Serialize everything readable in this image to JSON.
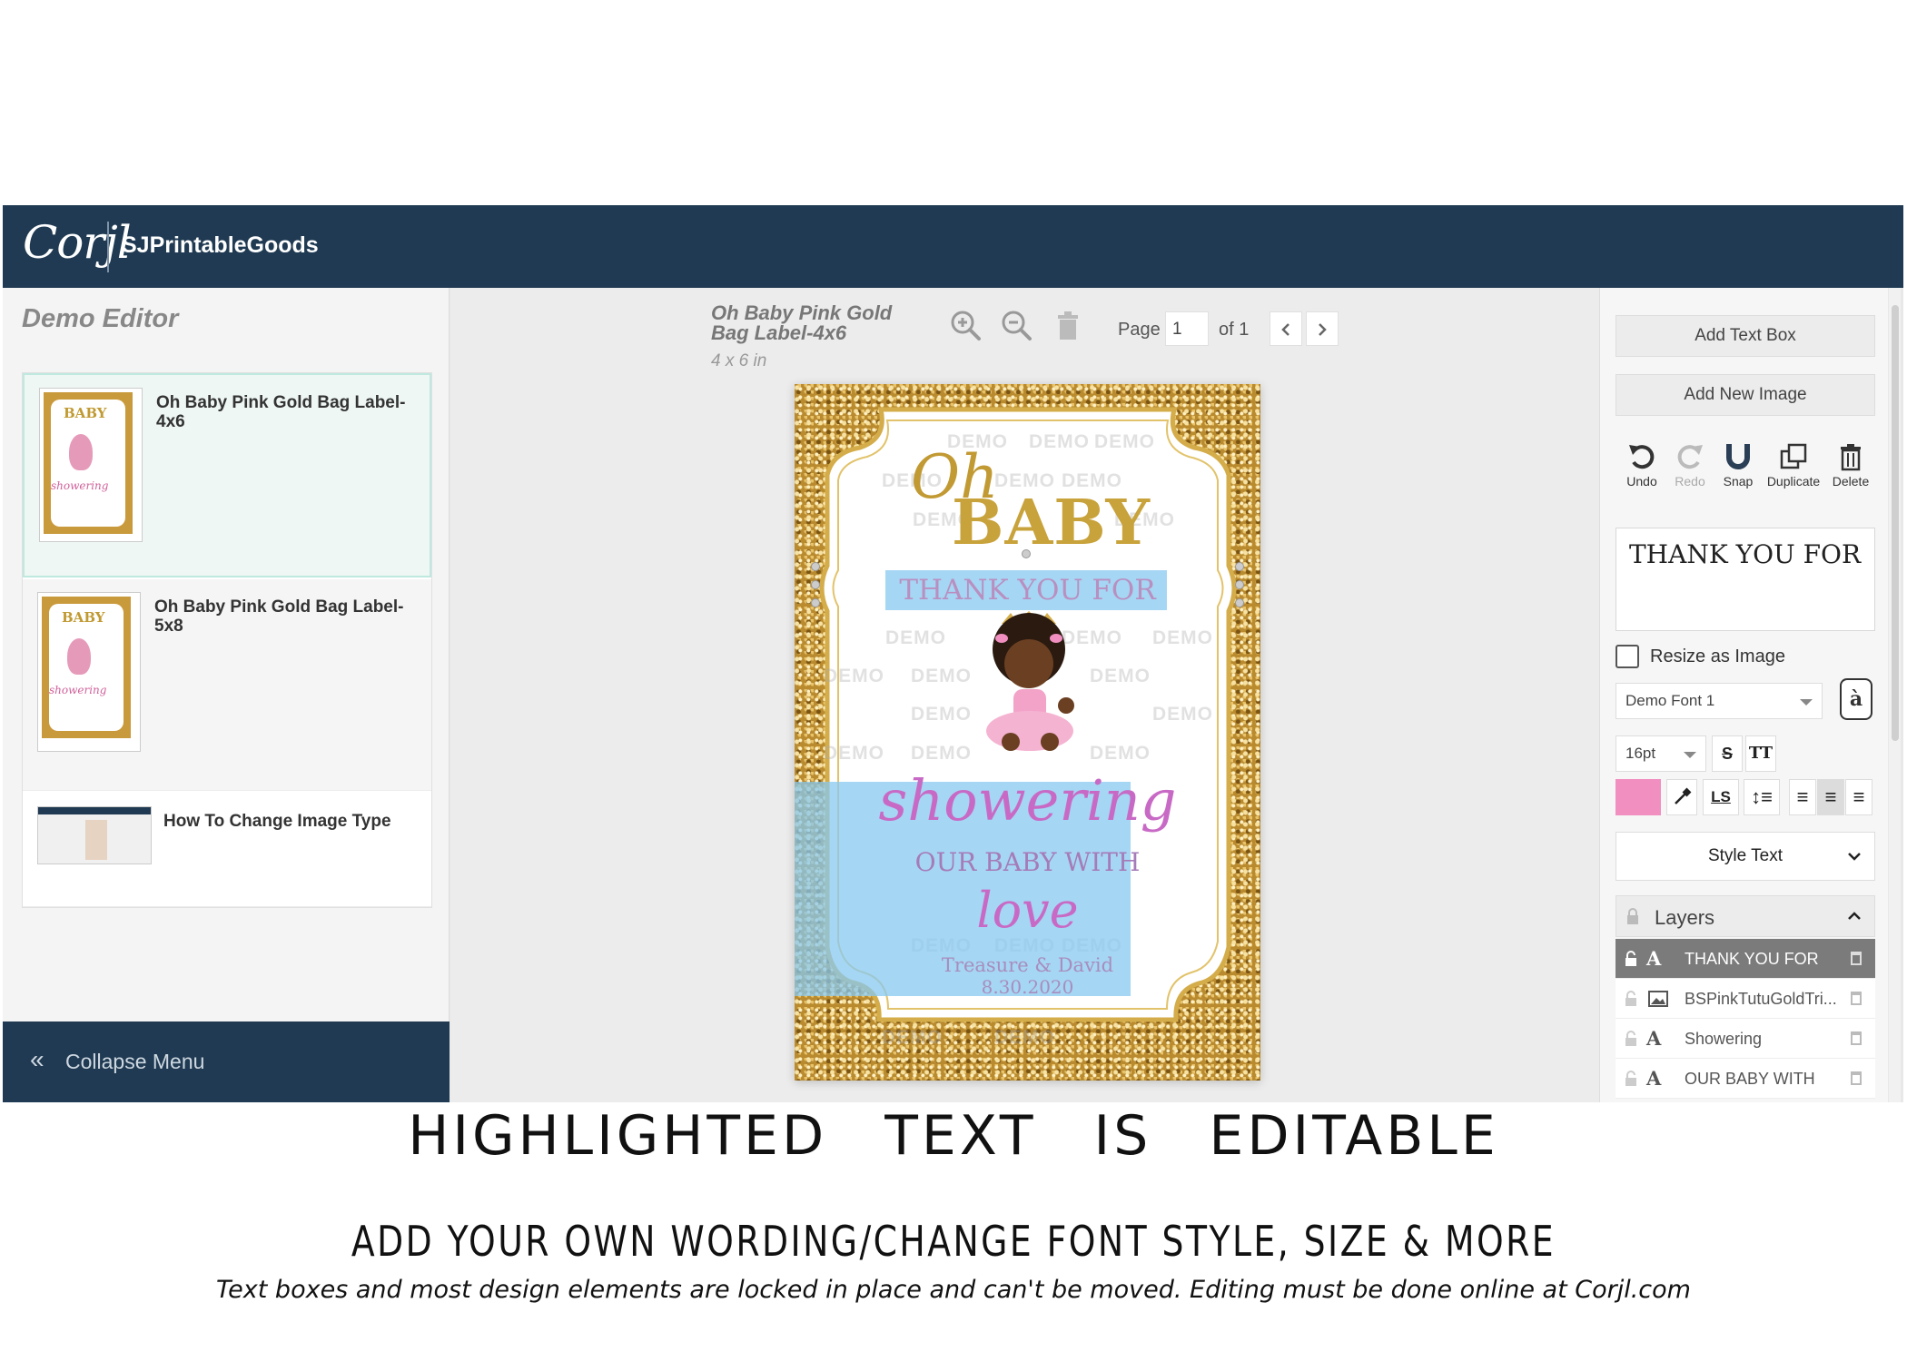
{
  "header": {
    "logo": "Corjl",
    "shop_name": "SJPrintableGoods"
  },
  "left_panel": {
    "title": "Demo Editor",
    "templates": [
      {
        "title": "Oh Baby Pink Gold Bag Label-4x6",
        "active": true
      },
      {
        "title": "Oh Baby Pink Gold Bag Label-5x8",
        "active": false
      },
      {
        "title": "How To Change Image Type",
        "active": false
      }
    ],
    "collapse_label": "Collapse Menu"
  },
  "toolbar": {
    "doc_title": "Oh Baby Pink Gold Bag Label-4x6",
    "doc_size": "4 x 6 in",
    "icons": [
      "zoom-in-icon",
      "zoom-out-icon",
      "trash-icon"
    ],
    "page_label": "Page",
    "page_value": "1",
    "page_of": "of 1"
  },
  "card": {
    "oh": "Oh",
    "baby": "BABY",
    "thank_you": "THANK YOU FOR",
    "showering": "showering",
    "our_baby_with": "OUR BABY WITH",
    "love": "love",
    "names": "Treasure & David",
    "date": "8.30.2020",
    "watermark": "DEMO"
  },
  "right_panel": {
    "add_text_box": "Add Text Box",
    "add_new_image": "Add New Image",
    "tools": [
      {
        "label": "Undo",
        "icon": "undo-icon",
        "enabled": true
      },
      {
        "label": "Redo",
        "icon": "redo-icon",
        "enabled": false
      },
      {
        "label": "Snap",
        "icon": "magnet-icon",
        "enabled": true
      },
      {
        "label": "Duplicate",
        "icon": "duplicate-icon",
        "enabled": true
      },
      {
        "label": "Delete",
        "icon": "trash-icon",
        "enabled": true
      }
    ],
    "text_value": "THANK YOU FOR",
    "resize_as_image": "Resize as Image",
    "font": "Demo Font 1",
    "font_size": "16pt",
    "text_color": "#f08fc0",
    "style_text": "Style Text",
    "layers_label": "Layers",
    "layers": [
      {
        "name": "THANK YOU FOR",
        "type": "text",
        "selected": true
      },
      {
        "name": "BSPinkTutuGoldTri...",
        "type": "image",
        "selected": false
      },
      {
        "name": "Showering",
        "type": "text",
        "selected": false
      },
      {
        "name": "OUR BABY WITH",
        "type": "text",
        "selected": false
      }
    ]
  },
  "captions": {
    "main": "HIGHLIGHTED TEXT IS EDITABLE",
    "sub": "ADD YOUR OWN WORDING/CHANGE FONT STYLE, SIZE & MORE",
    "note": "Text boxes and most design elements are locked in place and can't be moved. Editing must be done online at Corjl.com"
  }
}
